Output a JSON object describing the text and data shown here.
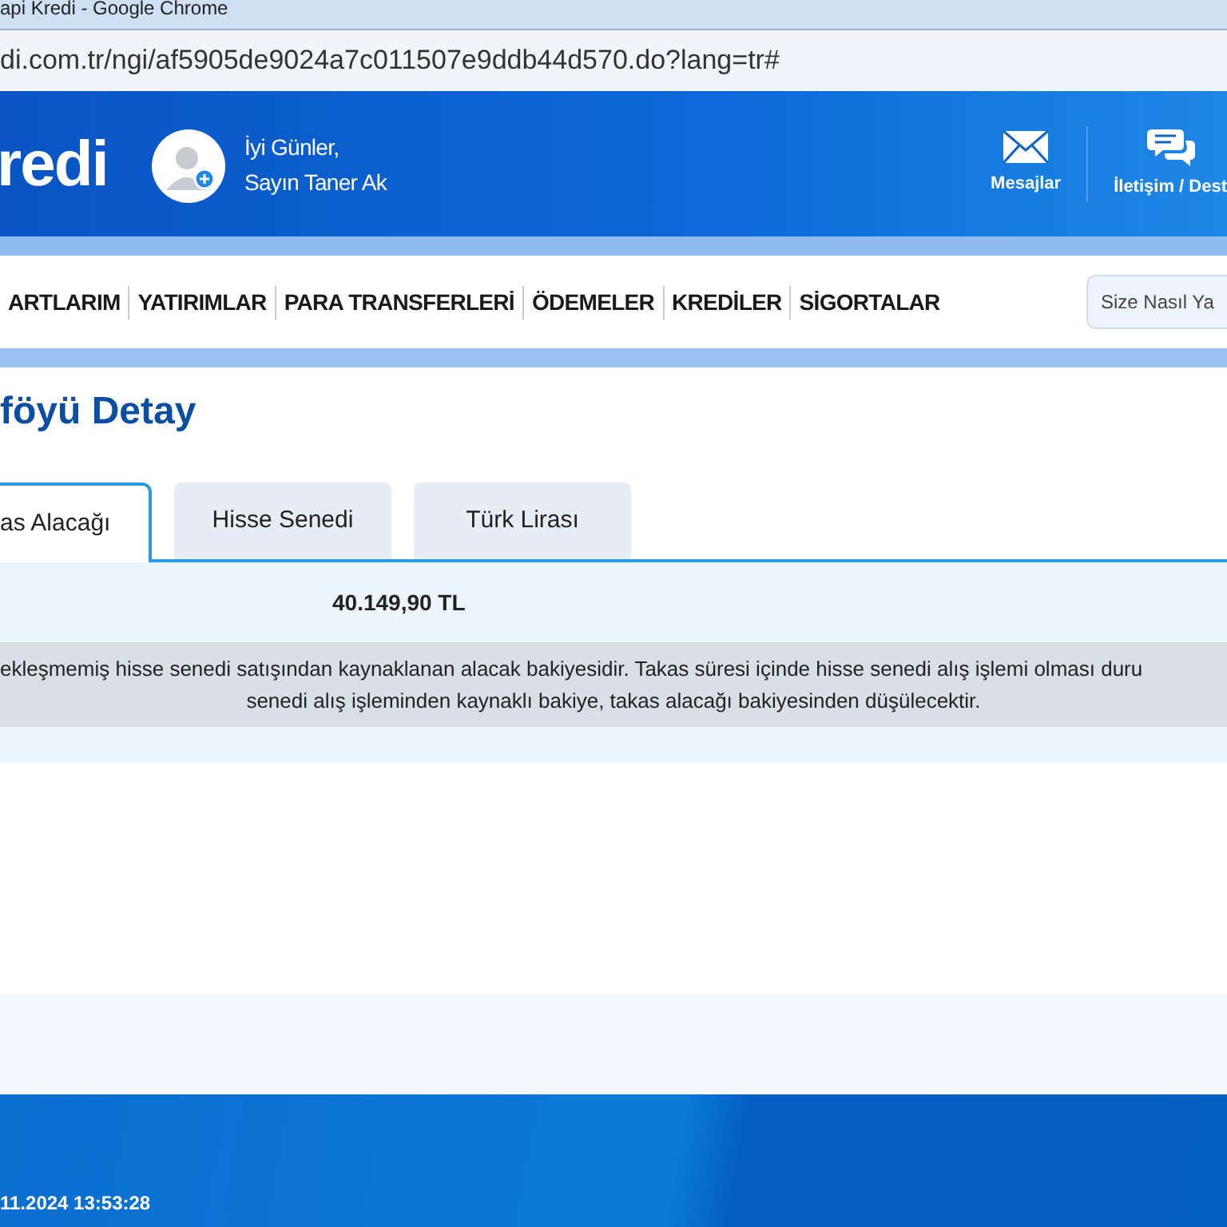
{
  "window": {
    "title": "api Kredi - Google Chrome"
  },
  "address_bar": {
    "url": "di.com.tr/ngi/af5905de9024a7c011507e9ddb44d570.do?lang=tr#"
  },
  "header": {
    "logo": "redi",
    "greeting": "İyi Günler,",
    "user": "Sayın Taner Ak",
    "actions": [
      {
        "label": "Mesajlar",
        "kind": "mail"
      },
      {
        "label": "İletişim / Dest",
        "kind": "chat"
      }
    ]
  },
  "nav": {
    "items": [
      "ARTLARIM",
      "YATIRIMLAR",
      "PARA TRANSFERLERİ",
      "ÖDEMELER",
      "KREDİLER",
      "SİGORTALAR"
    ],
    "search": {
      "placeholder": "Size Nasıl Ya"
    }
  },
  "page": {
    "title": "föyü Detay",
    "tabs": [
      {
        "label": "as Alacağı",
        "selected": true
      },
      {
        "label": "Hisse Senedi",
        "selected": false
      },
      {
        "label": "Türk Lirası",
        "selected": false
      }
    ],
    "amount": "40.149,90 TL",
    "info_lines": [
      "ekleşmemiş hisse senedi satışından kaynaklanan alacak bakiyesidir. Takas süresi içinde hisse senedi alış işlemi olması duru",
      "senedi alış işleminden kaynaklı bakiye, takas alacağı bakiyesinden düşülecektir."
    ]
  },
  "footer": {
    "last_login": "11.2024 13:53:28"
  }
}
